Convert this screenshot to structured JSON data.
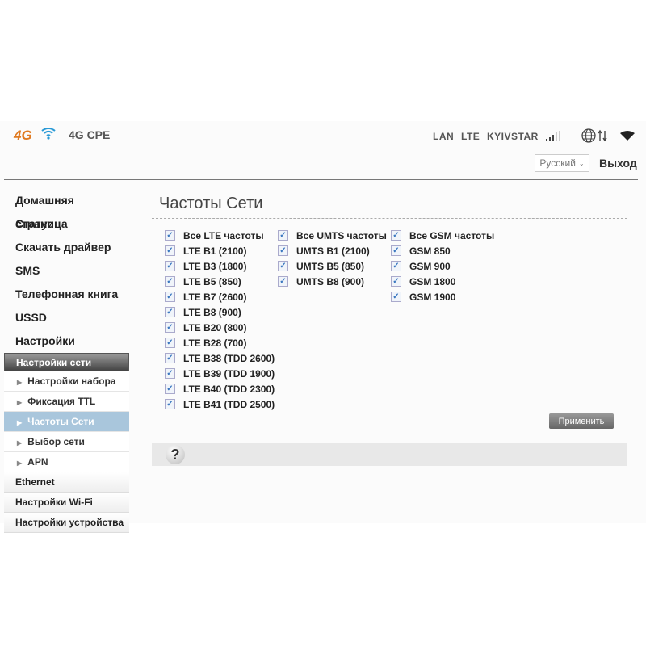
{
  "header": {
    "logo_text": "4G",
    "app_title": "4G CPE",
    "status": [
      "LAN",
      "LTE",
      "KYIVSTAR"
    ],
    "signal_bars": 3,
    "signal_max": 5,
    "language": "Русский",
    "logout": "Выход"
  },
  "sidebar": {
    "items": [
      "Домашняя страница",
      "Статус",
      "Скачать драйвер",
      "SMS",
      "Телефонная книга",
      "USSD",
      "Настройки"
    ],
    "group": "Настройки сети",
    "sub": [
      {
        "label": "Настройки набора",
        "active": false
      },
      {
        "label": "Фиксация TTL",
        "active": false
      },
      {
        "label": "Частоты Сети",
        "active": true
      },
      {
        "label": "Выбор сети",
        "active": false
      },
      {
        "label": "APN",
        "active": false
      }
    ],
    "sections": [
      "Ethernet",
      "Настройки Wi-Fi",
      "Настройки устройства"
    ]
  },
  "main": {
    "title": "Частоты Сети",
    "columns": [
      [
        "Все LTE частоты",
        "LTE B1 (2100)",
        "LTE B3 (1800)",
        "LTE B5 (850)",
        "LTE B7 (2600)",
        "LTE B8 (900)",
        "LTE B20 (800)",
        "LTE B28 (700)",
        "LTE B38 (TDD 2600)",
        "LTE B39 (TDD 1900)",
        "LTE B40 (TDD 2300)",
        "LTE B41 (TDD 2500)"
      ],
      [
        "Все UMTS частоты",
        "UMTS B1 (2100)",
        "UMTS B5 (850)",
        "UMTS B8 (900)"
      ],
      [
        "Все GSM частоты",
        "GSM 850",
        "GSM 900",
        "GSM 1800",
        "GSM 1900"
      ]
    ],
    "all_checked": true,
    "apply": "Применить",
    "help_icon": "?"
  }
}
